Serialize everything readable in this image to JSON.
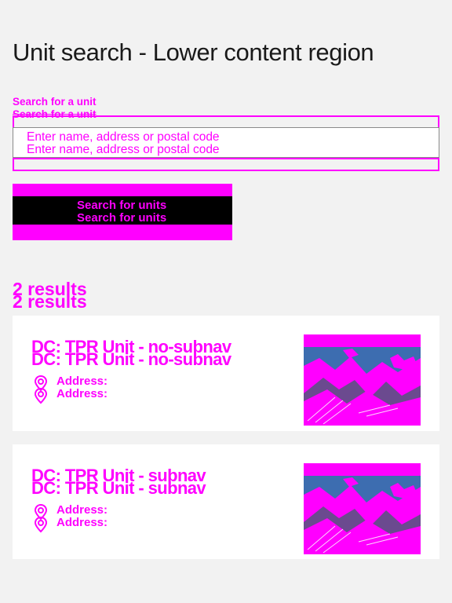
{
  "page": {
    "title": "Unit search - Lower content region"
  },
  "search": {
    "label": "Search for a unit",
    "placeholder": "Enter name, address or postal code",
    "button_label": "Search for units"
  },
  "results": {
    "count_text": "2 results",
    "items": [
      {
        "name": "DC: TPR Unit - no-subnav",
        "address_label": "Address:",
        "icon": "location-pin-icon",
        "image": "unit-thumbnail"
      },
      {
        "name": "DC: TPR Unit - subnav",
        "address_label": "Address:",
        "icon": "location-pin-icon",
        "image": "unit-thumbnail"
      }
    ]
  },
  "colors": {
    "background": "#f2f2f2",
    "card": "#ffffff",
    "accent": "#ff00ff",
    "button_core": "#000000",
    "text": "#1a1a1a"
  }
}
